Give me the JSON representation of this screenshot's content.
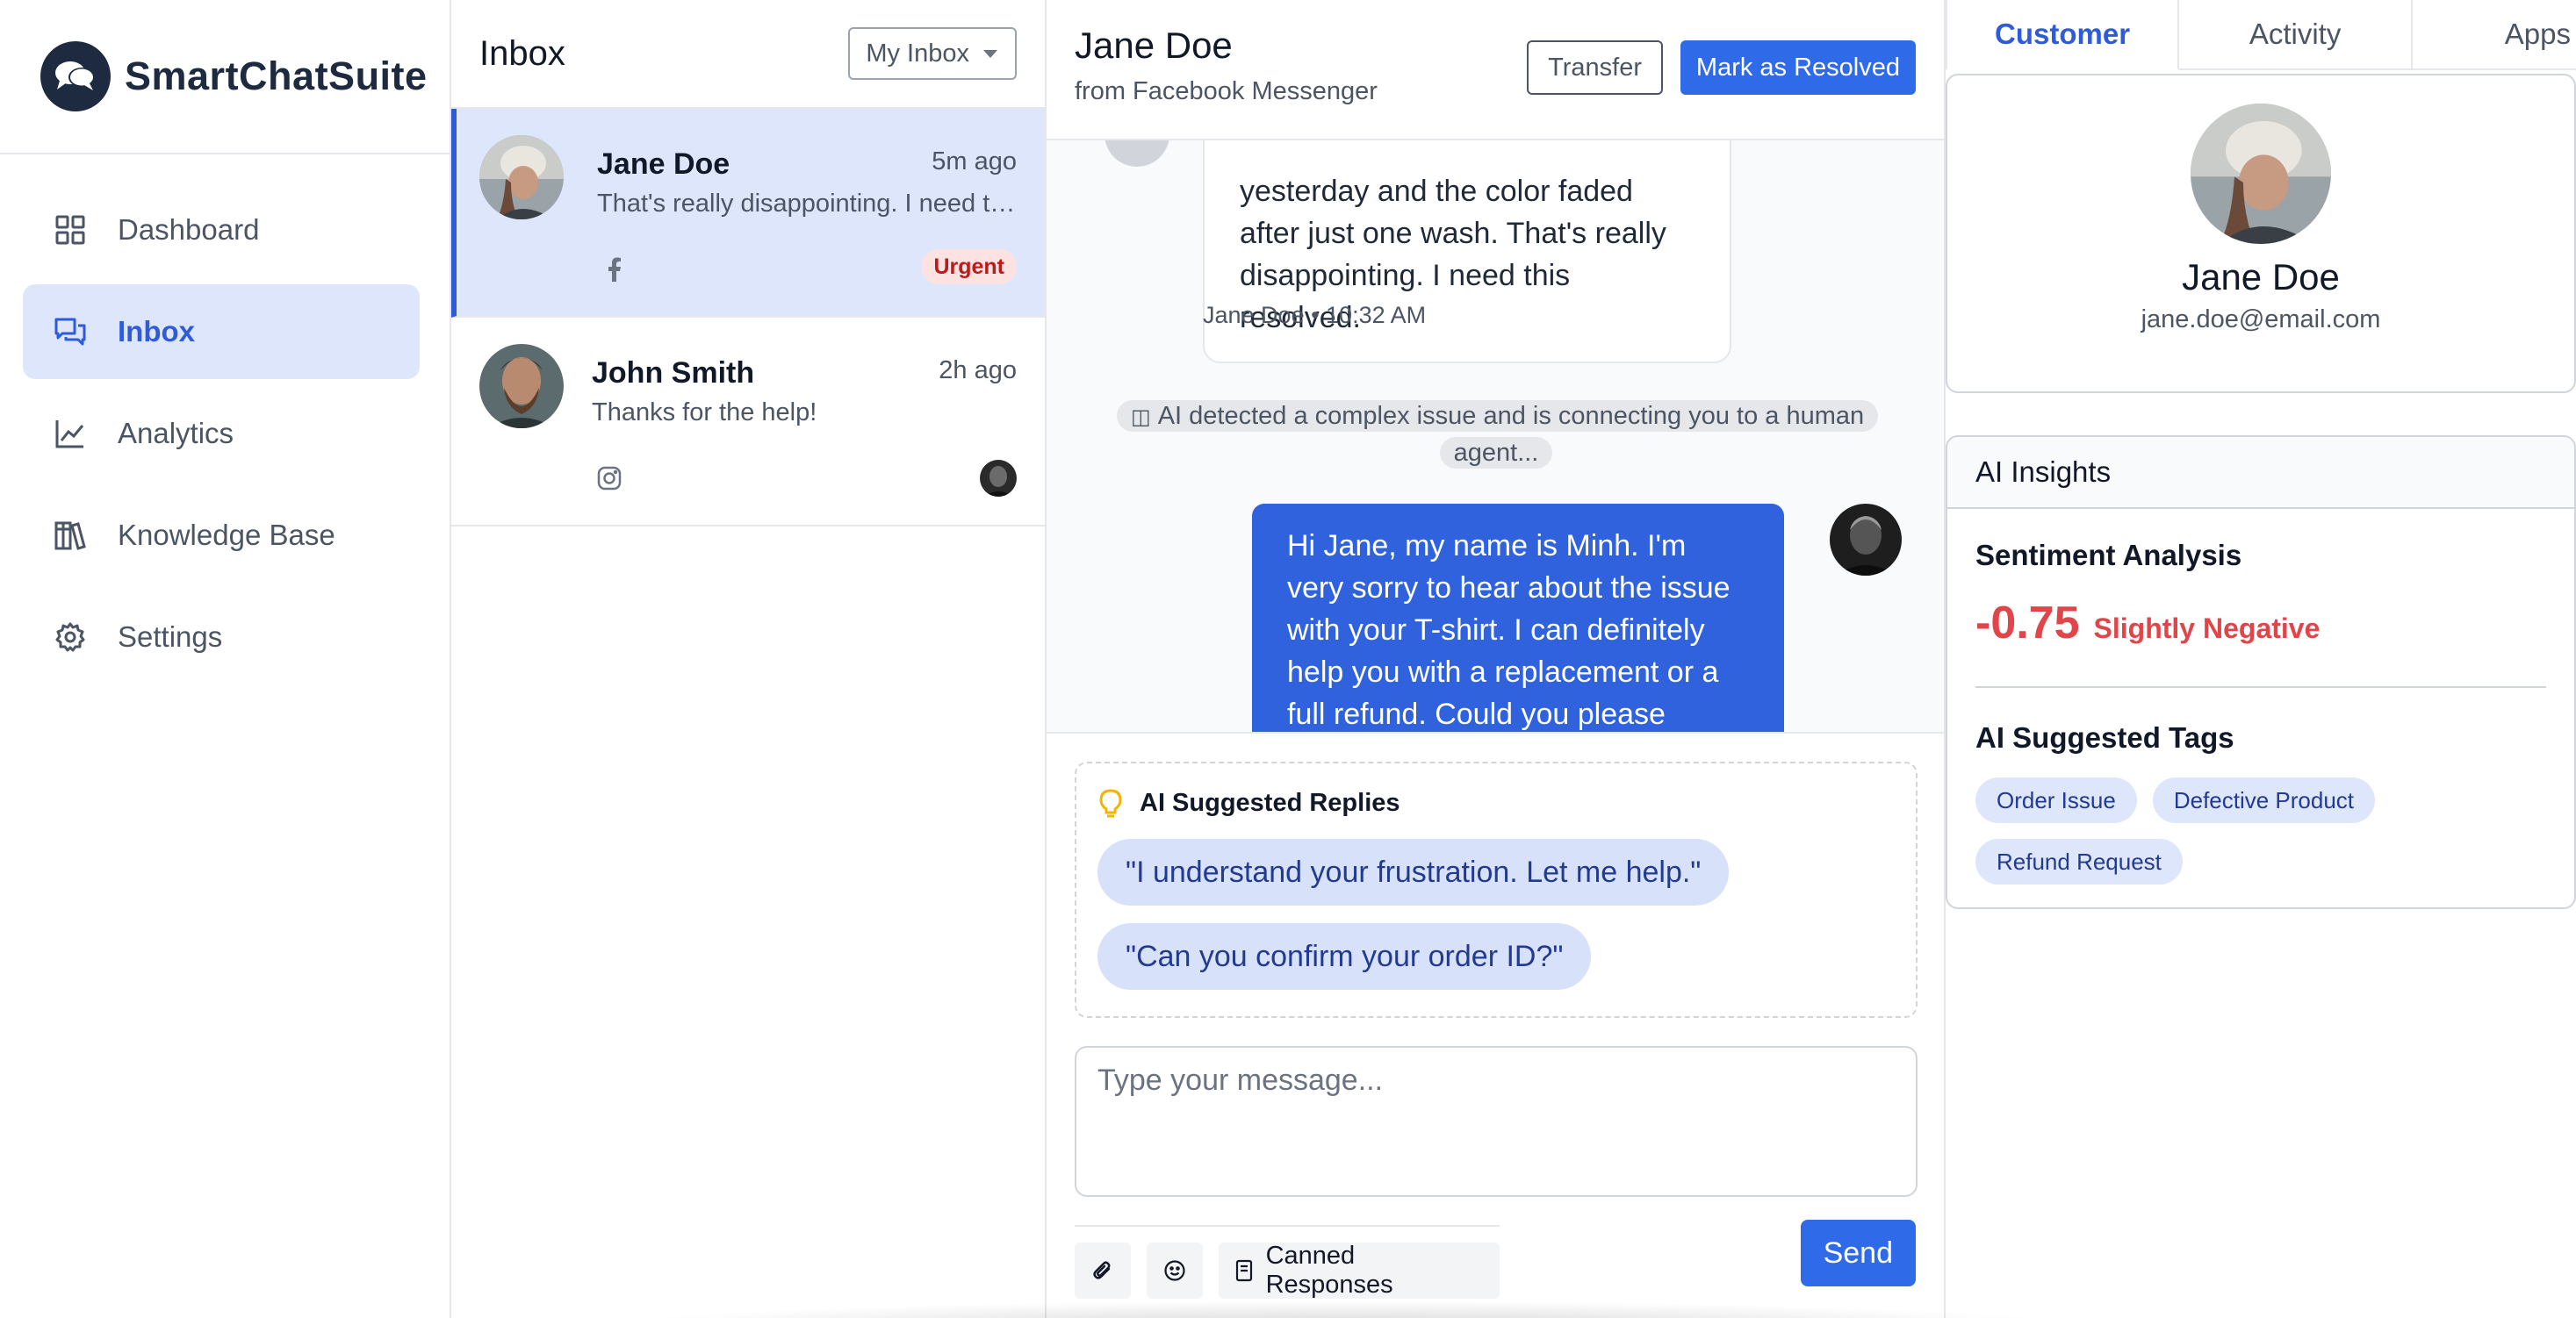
{
  "app": {
    "name": "SmartChatSuite"
  },
  "nav": {
    "items": [
      {
        "label": "Dashboard",
        "icon": "grid-icon"
      },
      {
        "label": "Inbox",
        "icon": "chat-bubbles-icon",
        "active": true
      },
      {
        "label": "Analytics",
        "icon": "line-chart-icon"
      },
      {
        "label": "Knowledge Base",
        "icon": "books-icon"
      },
      {
        "label": "Settings",
        "icon": "gear-icon"
      }
    ]
  },
  "inbox": {
    "title": "Inbox",
    "filter": "My Inbox",
    "conversations": [
      {
        "name": "Jane Doe",
        "time": "5m ago",
        "preview": "That's really disappointing. I need this resolved.",
        "channel": "facebook-icon",
        "badge": "Urgent",
        "active": true
      },
      {
        "name": "John Smith",
        "time": "2h ago",
        "preview": "Thanks for the help!",
        "channel": "instagram-icon"
      }
    ]
  },
  "chat": {
    "name": "Jane Doe",
    "source": "from Facebook Messenger",
    "transfer_label": "Transfer",
    "resolve_label": "Mark as Resolved",
    "incoming_text": "yesterday and the color faded after just one wash. That's really disappointing. I need this resolved.",
    "incoming_meta": "Jane Doe • 10:32 AM",
    "system_note": "AI detected a complex issue and is connecting you to a human agent...",
    "outgoing_text": "Hi Jane, my name is Minh. I'm very sorry to hear about the issue with your T-shirt. I can definitely help you with a replacement or a full refund. Could you please provide",
    "suggested_title": "AI Suggested Replies",
    "suggested_replies": [
      "\"I understand your frustration. Let me help.\"",
      "\"Can you confirm your order ID?\""
    ],
    "composer_placeholder": "Type your message...",
    "canned_label": "Canned Responses",
    "send_label": "Send"
  },
  "details": {
    "tabs": [
      "Customer",
      "Activity",
      "Apps"
    ],
    "customer": {
      "name": "Jane Doe",
      "email": "jane.doe@email.com"
    },
    "insights": {
      "title": "AI Insights",
      "sentiment_title": "Sentiment Analysis",
      "sentiment_score": "-0.75",
      "sentiment_label": "Slightly Negative",
      "tags_title": "AI Suggested Tags",
      "tags": [
        "Order Issue",
        "Defective Product",
        "Refund Request"
      ]
    }
  },
  "colors": {
    "accent": "#2f6ae8",
    "active_bg": "#dde6fb",
    "negative": "#e0454a",
    "brand_dark": "#1e2a3f"
  }
}
